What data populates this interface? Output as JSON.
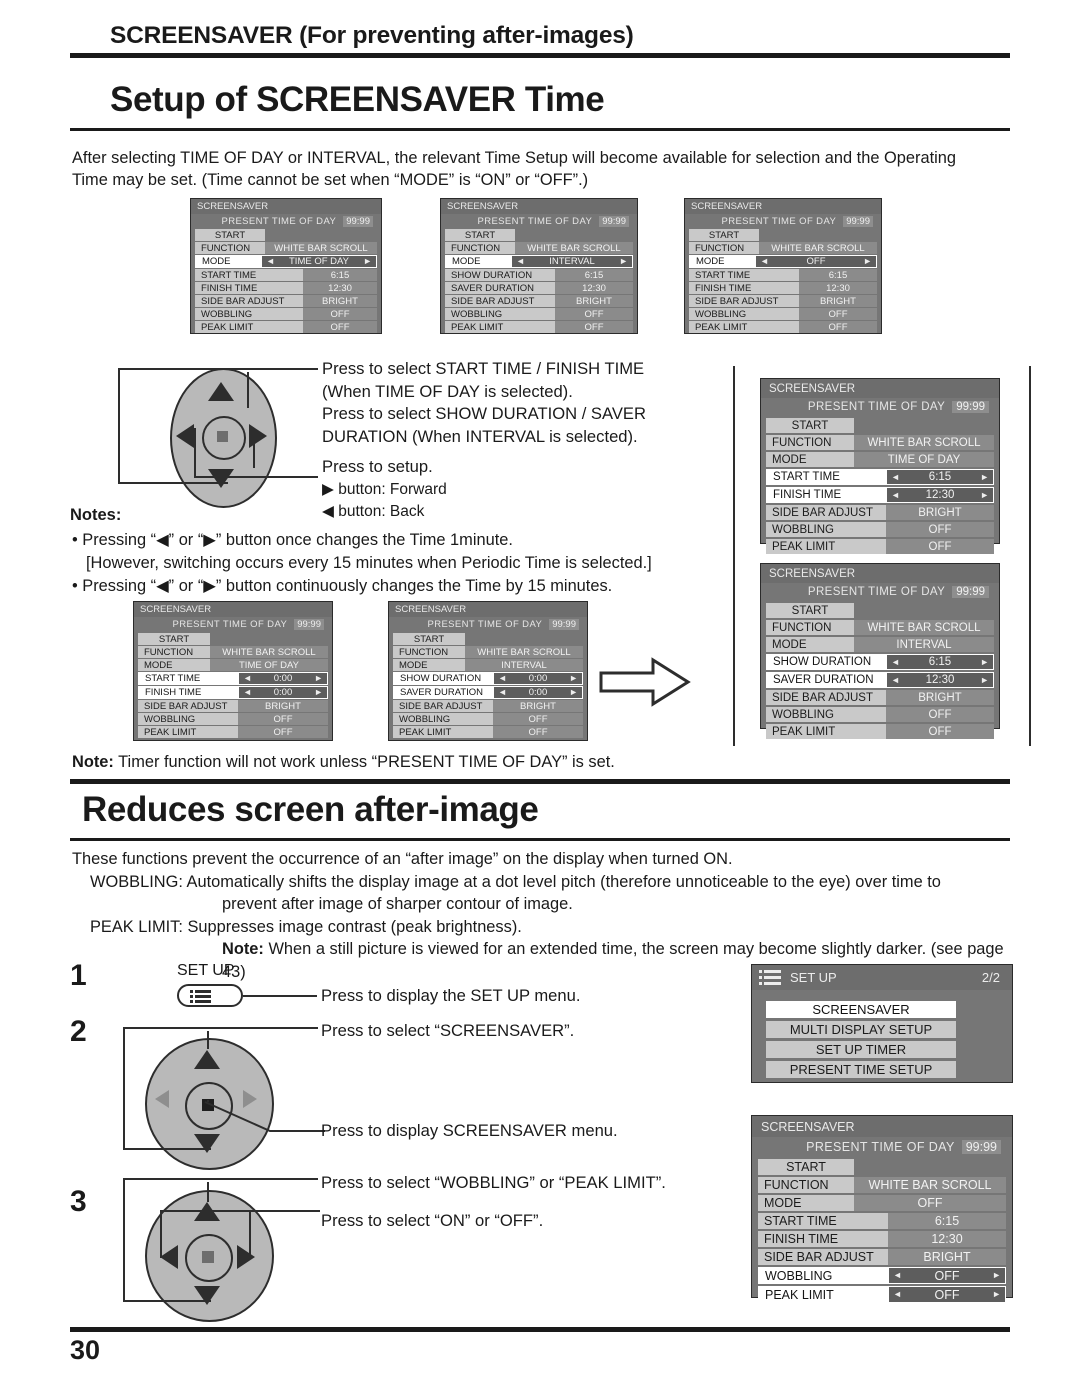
{
  "chapter_title": "SCREENSAVER (For preventing after-images)",
  "section1": {
    "title": "Setup of SCREENSAVER Time",
    "intro_line1": "After selecting TIME OF DAY or INTERVAL, the relevant Time Setup will become available for selection and the Operating",
    "intro_line2": "Time may be set. (Time cannot be set when “MODE” is “ON” or “OFF”.)"
  },
  "osd_common": {
    "title": "SCREENSAVER",
    "present_label": "PRESENT  TIME OF DAY",
    "present_value": "99:99",
    "start_label": "START",
    "keys": {
      "function": "FUNCTION",
      "mode": "MODE",
      "start_time": "START TIME",
      "finish_time": "FINISH TIME",
      "show_duration": "SHOW DURATION",
      "saver_duration": "SAVER DURATION",
      "side_bar_adjust": "SIDE BAR ADJUST",
      "wobbling": "WOBBLING",
      "peak_limit": "PEAK LIMIT"
    },
    "values": {
      "function": "WHITE BAR SCROLL",
      "mode_time_of_day": "TIME OF DAY",
      "mode_interval": "INTERVAL",
      "mode_off": "OFF",
      "time_615": "6:15",
      "time_1230": "12:30",
      "time_000": "0:00",
      "bright": "BRIGHT",
      "off": "OFF"
    },
    "arrow_left": "◄",
    "arrow_right": "►"
  },
  "callouts": {
    "select_time_l1": "Press to select START TIME / FINISH TIME",
    "select_time_l2": "(When TIME OF DAY is selected).",
    "select_time_l3": "Press to select SHOW DURATION / SAVER",
    "select_time_l4": "DURATION (When INTERVAL is selected).",
    "setup_l1": "Press to setup.",
    "setup_l2": "▶ button: Forward",
    "setup_l3": "◀ button: Back"
  },
  "notes": {
    "heading": "Notes:",
    "n1": "• Pressing “◀” or “▶” button once changes the Time 1minute.",
    "n2": "[However, switching occurs every 15 minutes when Periodic Time is selected.]",
    "n3": "• Pressing “◀” or “▶” button continuously changes the Time by 15 minutes."
  },
  "timer_note": {
    "bold": "Note:",
    "text": " Timer function will not work unless “PRESENT TIME OF DAY” is set."
  },
  "section2": {
    "title": "Reduces screen after-image",
    "intro": "These functions prevent the occurrence of an “after image” on the display when turned ON.",
    "wobbling_label": "WOBBLING:",
    "wobbling_l1": " Automatically shifts the display image at a dot level pitch (therefore unnoticeable to the eye) over time to",
    "wobbling_l2": "prevent after image of sharper contour of image.",
    "peak_label": "PEAK LIMIT:",
    "peak_text": " Suppresses image contrast (peak brightness).",
    "note_bold": "Note:",
    "note_text": " When a still picture is viewed for an extended time, the screen may become slightly darker. (see page 43)"
  },
  "steps": [
    {
      "num": "1",
      "button_label": "SET UP",
      "text": "Press to display the SET UP menu."
    },
    {
      "num": "2",
      "text_top": "Press to select “SCREENSAVER”.",
      "text_mid": "Press to display SCREENSAVER menu."
    },
    {
      "num": "3",
      "text_top": "Press to select “WOBBLING” or “PEAK LIMIT”.",
      "text_mid": "Press to select “ON” or “OFF”."
    }
  ],
  "setup_menu": {
    "title": "SET UP",
    "page": "2/2",
    "items": [
      "SCREENSAVER",
      "MULTI DISPLAY SETUP",
      "SET UP TIMER",
      "PRESENT TIME SETUP"
    ],
    "selected_index": 0
  },
  "page_number": "30"
}
